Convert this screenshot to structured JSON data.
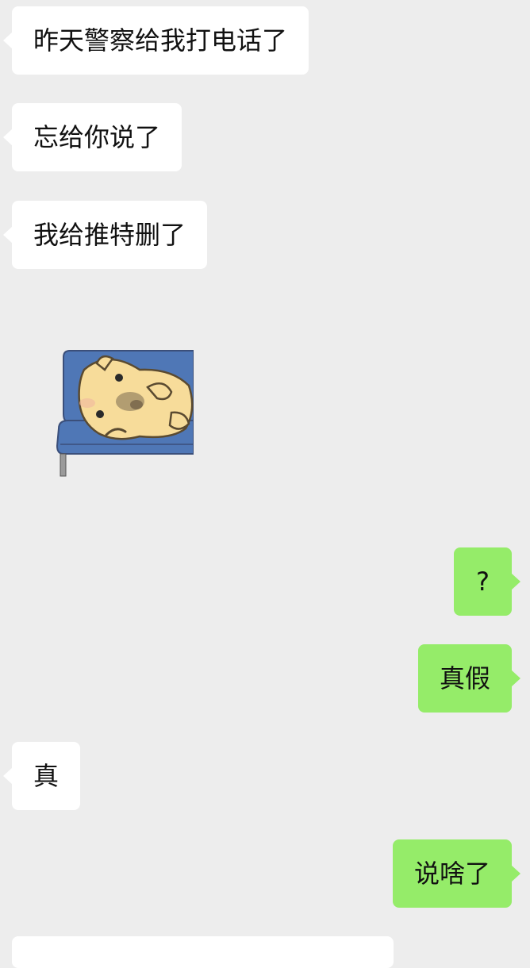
{
  "chat": {
    "messages": [
      {
        "side": "in",
        "text": "昨天警察给我打电话了"
      },
      {
        "side": "in",
        "text": "忘给你说了"
      },
      {
        "side": "in",
        "text": "我给推特删了"
      },
      {
        "side": "in",
        "type": "sticker",
        "sticker_name": "sad-pig-on-sofa-sticker"
      },
      {
        "side": "out",
        "text": "?"
      },
      {
        "side": "out",
        "text": "真假"
      },
      {
        "side": "in",
        "text": "真"
      },
      {
        "side": "out",
        "text": "说啥了"
      }
    ]
  },
  "colors": {
    "background": "#ededed",
    "incoming_bubble": "#ffffff",
    "outgoing_bubble": "#95ec69",
    "text": "#111111"
  }
}
